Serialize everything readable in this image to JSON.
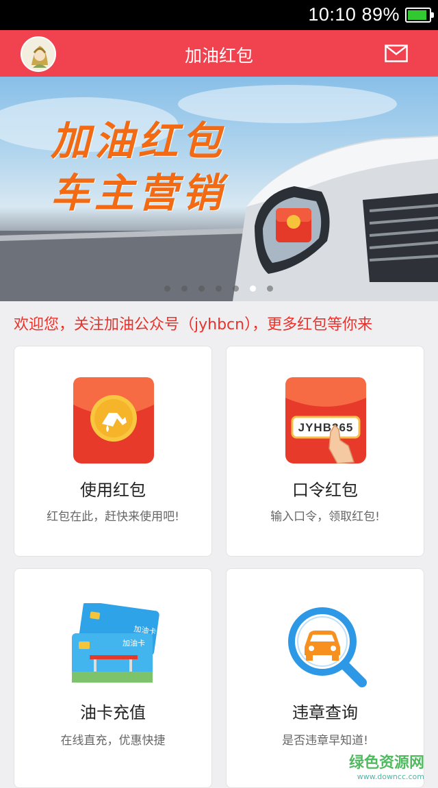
{
  "status_bar": {
    "time": "10:10",
    "battery": "89%",
    "battery_level": 0.89
  },
  "header": {
    "title": "加油红包"
  },
  "banner": {
    "line1": "加油红包",
    "line2": "车主营销",
    "slide_count": 7,
    "active_slide": 6
  },
  "notice": "欢迎您，关注加油公众号（jyhbcn），更多红包等你来",
  "cards": [
    {
      "title": "使用红包",
      "desc": "红包在此，赶快来使用吧!"
    },
    {
      "title": "口令红包",
      "desc": "输入口令，领取红包!",
      "code": "JYHB365"
    },
    {
      "title": "油卡充值",
      "desc": "在线直充，优惠快捷",
      "card_label": "加油卡"
    },
    {
      "title": "违章查询",
      "desc": "是否违章早知道!"
    }
  ],
  "watermark": {
    "main": "绿色资源网",
    "sub": "www.downcc.com"
  },
  "colors": {
    "brand_red": "#f0424f",
    "notice_red": "#e8322a",
    "banner_orange": "#f26a14"
  }
}
